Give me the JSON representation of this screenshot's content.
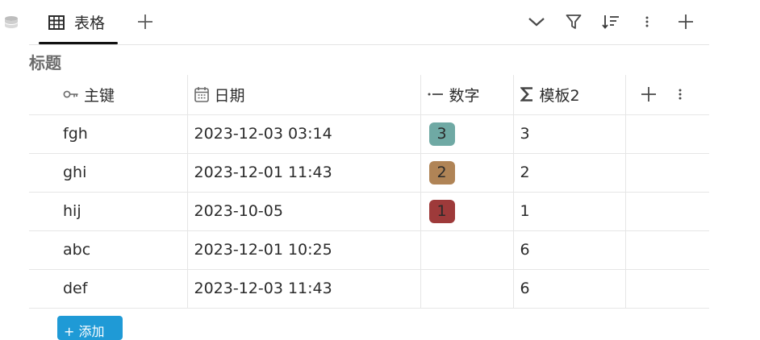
{
  "view": {
    "tab_label": "表格",
    "table_title": "标题"
  },
  "columns": [
    {
      "label": "主键",
      "icon": "key-icon"
    },
    {
      "label": "日期",
      "icon": "calendar-icon"
    },
    {
      "label": "数字",
      "icon": "number-icon"
    },
    {
      "label": "模板2",
      "icon": "sigma-icon"
    }
  ],
  "rows": [
    {
      "key": "fgh",
      "date": "2023-12-03 03:14",
      "number": "3",
      "number_color": "#6fa9a4",
      "template": "3"
    },
    {
      "key": "ghi",
      "date": "2023-12-01 11:43",
      "number": "2",
      "number_color": "#b08456",
      "template": "2"
    },
    {
      "key": "hij",
      "date": "2023-10-05",
      "number": "1",
      "number_color": "#9e3a3a",
      "template": "1"
    },
    {
      "key": "abc",
      "date": "2023-12-01 10:25",
      "number": "",
      "number_color": "",
      "template": "6"
    },
    {
      "key": "def",
      "date": "2023-12-03 11:43",
      "number": "",
      "number_color": "",
      "template": "6"
    }
  ],
  "footer": {
    "add_row_label": "+ 添加"
  },
  "colors": {
    "accent": "#1f9ad6",
    "border": "#e6e6e6",
    "text": "#2b2b2b",
    "muted": "#6b6b6b"
  }
}
